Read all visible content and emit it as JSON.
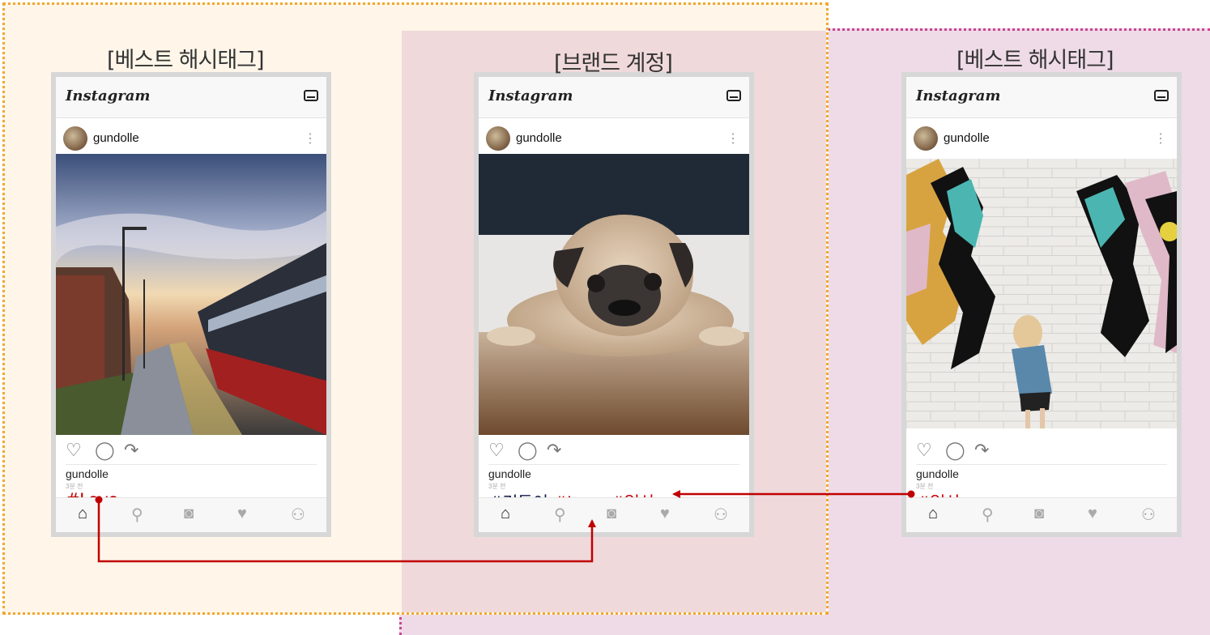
{
  "sections": [
    {
      "title": "[베스트 해시태그]"
    },
    {
      "title": "[브랜드 계정]"
    },
    {
      "title": "[베스트 해시태그]"
    }
  ],
  "phones": [
    {
      "app_name": "Instagram",
      "username": "gundolle",
      "caption_user": "gundolle",
      "time_ago": "3분 전",
      "hashtags": [
        {
          "text": "#Love",
          "color": "red"
        }
      ]
    },
    {
      "app_name": "Instagram",
      "username": "gundolle",
      "caption_user": "gundolle",
      "time_ago": "3분 전",
      "hashtags": [
        {
          "text": "#건돌이",
          "color": "navy"
        },
        {
          "text": "#Love",
          "color": "red"
        },
        {
          "text": "#일상",
          "color": "red"
        }
      ]
    },
    {
      "app_name": "Instagram",
      "username": "gundolle",
      "caption_user": "gundolle",
      "time_ago": "3분 전",
      "hashtags": [
        {
          "text": "#일상",
          "color": "red"
        }
      ]
    }
  ],
  "icons": {
    "more": "more-vertical-icon",
    "actions": [
      "heart-icon",
      "comment-icon",
      "share-icon"
    ],
    "nav": [
      "home-icon",
      "search-icon",
      "camera-icon",
      "heart-icon",
      "profile-icon"
    ]
  },
  "colors": {
    "region_left": "#fff6e9",
    "region_left_border": "#f0a830",
    "region_right": "#efdbe8",
    "region_right_border": "#c8458f",
    "overlap": "#f0d9da",
    "hashtag_red": "#c00000",
    "hashtag_navy": "#0e1a4a",
    "arrow": "#c00000"
  }
}
